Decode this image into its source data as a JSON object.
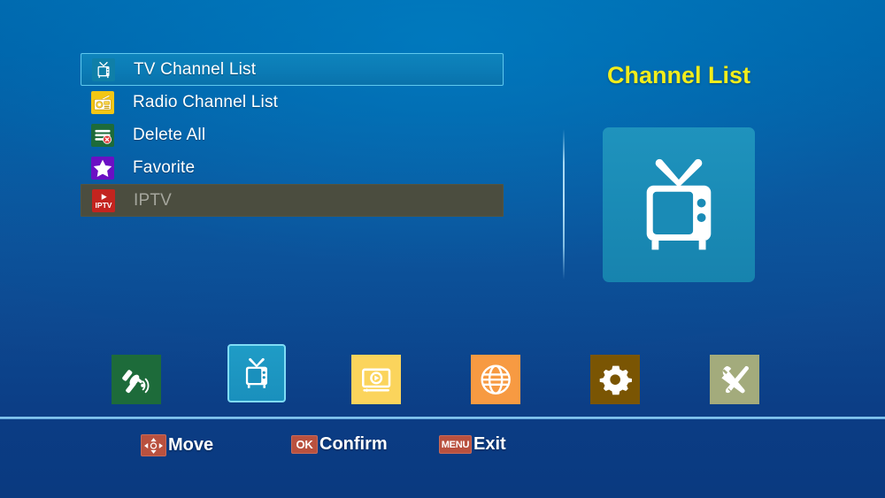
{
  "screen": {
    "background_top": "#0069ae",
    "background_bottom": "#0a3a80",
    "footer_bg": "#0b3c84",
    "accent_yellow": "#f2ed1b",
    "accent_cyan": "#5fc8ee",
    "keycap_red": "#b9513f"
  },
  "menu": {
    "items": [
      {
        "label": "TV Channel List",
        "icon": "tv-icon",
        "state": "selected",
        "tile_color": "#0f7fa8"
      },
      {
        "label": "Radio Channel List",
        "icon": "radio-icon",
        "state": "normal",
        "tile_color": "#f3c614"
      },
      {
        "label": "Delete All",
        "icon": "delete-list-icon",
        "state": "normal",
        "tile_color": "#1d6b3a"
      },
      {
        "label": "Favorite",
        "icon": "star-icon",
        "state": "normal",
        "tile_color": "#6b10c4"
      },
      {
        "label": "IPTV",
        "icon": "iptv-icon",
        "state": "disabled",
        "tile_color": "#c3241f"
      }
    ]
  },
  "panel": {
    "title": "Channel List",
    "icon": "tv-icon",
    "tile_color": "#1a8bb6"
  },
  "iconbar": {
    "items": [
      {
        "name": "installation",
        "icon": "satellite-dish-icon",
        "tile_color": "#1d6b3a",
        "active": false
      },
      {
        "name": "channel",
        "icon": "tv-icon",
        "tile_color": "#1a90bd",
        "active": true
      },
      {
        "name": "media",
        "icon": "media-player-icon",
        "tile_color": "#fbd45c",
        "active": false
      },
      {
        "name": "network",
        "icon": "globe-icon",
        "tile_color": "#f79a42",
        "active": false
      },
      {
        "name": "settings",
        "icon": "gear-icon",
        "tile_color": "#7a5503",
        "active": false
      },
      {
        "name": "tools",
        "icon": "tools-icon",
        "tile_color": "#a3ab7c",
        "active": false
      }
    ]
  },
  "footer": {
    "hints": [
      {
        "key": "dpad",
        "key_label": "",
        "label": "Move"
      },
      {
        "key": "ok",
        "key_label": "OK",
        "label": "Confirm"
      },
      {
        "key": "menu",
        "key_label": "MENU",
        "label": "Exit"
      }
    ]
  }
}
